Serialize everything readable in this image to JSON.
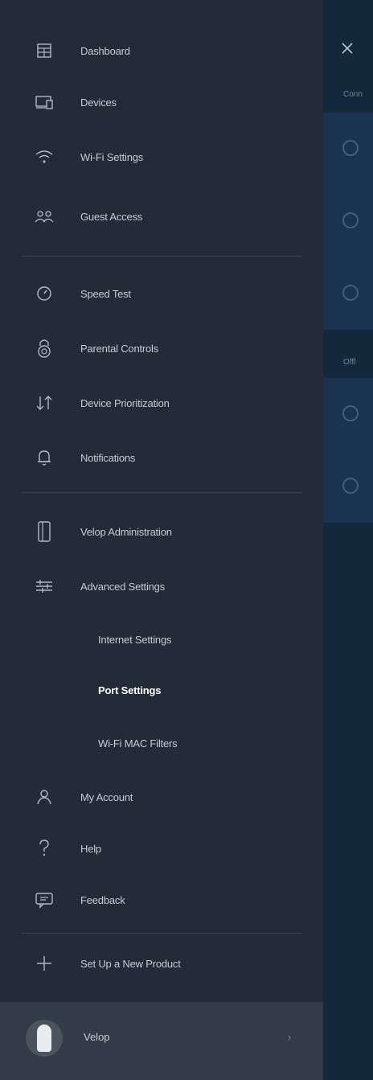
{
  "background": {
    "sections": [
      "Conn",
      "Offl"
    ]
  },
  "nav": {
    "items": [
      {
        "label": "Dashboard",
        "icon": "dashboard-icon"
      },
      {
        "label": "Devices",
        "icon": "devices-icon"
      },
      {
        "label": "Wi-Fi Settings",
        "icon": "wifi-icon"
      },
      {
        "label": "Guest Access",
        "icon": "guest-access-icon"
      },
      {
        "label": "Speed Test",
        "icon": "speedometer-icon"
      },
      {
        "label": "Parental Controls",
        "icon": "lock-icon"
      },
      {
        "label": "Device Prioritization",
        "icon": "up-down-arrows-icon"
      },
      {
        "label": "Notifications",
        "icon": "bell-icon"
      },
      {
        "label": "Velop Administration",
        "icon": "node-icon"
      },
      {
        "label": "Advanced Settings",
        "icon": "sliders-icon"
      }
    ],
    "subitems": [
      {
        "label": "Internet Settings",
        "active": false
      },
      {
        "label": "Port Settings",
        "active": true
      },
      {
        "label": "Wi-Fi MAC Filters",
        "active": false
      }
    ],
    "bottom_items": [
      {
        "label": "My Account",
        "icon": "user-icon"
      },
      {
        "label": "Help",
        "icon": "question-icon"
      },
      {
        "label": "Feedback",
        "icon": "feedback-icon"
      }
    ],
    "setup": {
      "label": "Set Up a New Product",
      "icon": "plus-icon"
    }
  },
  "footer": {
    "label": "Velop",
    "chevron": "›"
  },
  "colors": {
    "drawer_bg": "#222b37",
    "right_panel_bg": "#14283b",
    "footer_bg": "#323b47",
    "text": "#c3ccd5",
    "active_text": "#ffffff"
  }
}
